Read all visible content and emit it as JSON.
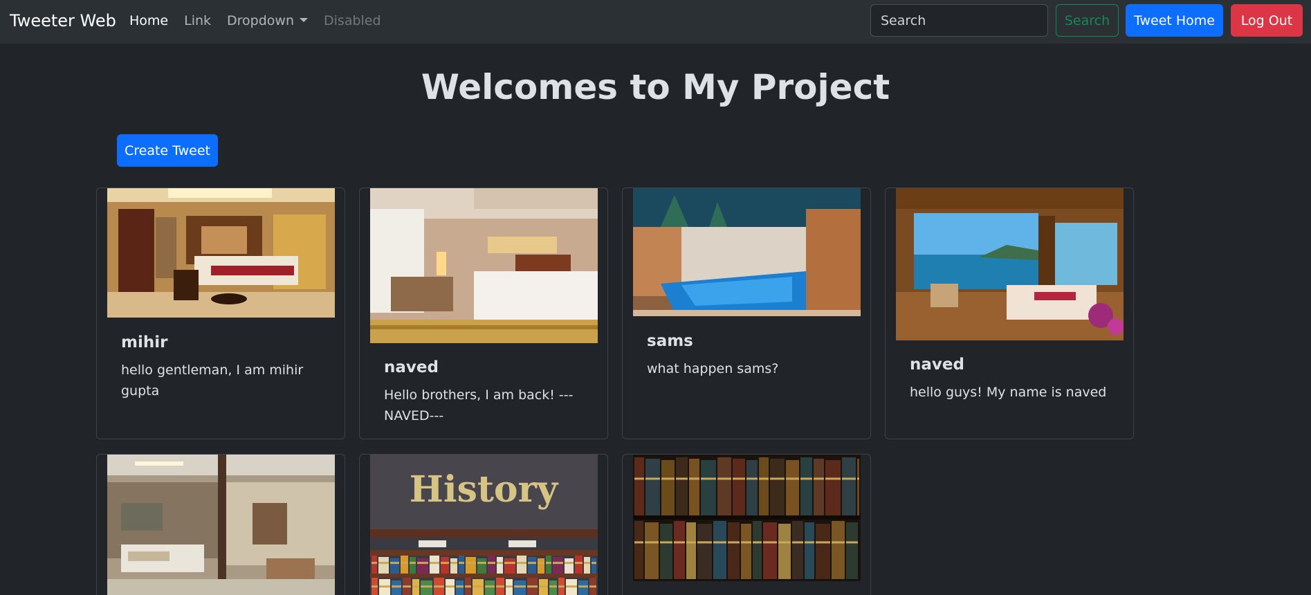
{
  "navbar": {
    "brand": "Tweeter Web",
    "links": [
      {
        "label": "Home",
        "state": "active"
      },
      {
        "label": "Link",
        "state": "normal"
      },
      {
        "label": "Dropdown",
        "state": "dropdown"
      },
      {
        "label": "Disabled",
        "state": "disabled"
      }
    ],
    "search_placeholder": "Search",
    "search_button": "Search",
    "tweet_home_button": "Tweet Home",
    "logout_button": "Log Out"
  },
  "page": {
    "title": "Welcomes to My Project",
    "create_button": "Create Tweet"
  },
  "tweets": [
    {
      "user": "mihir",
      "text": "hello gentleman, I am mihir gupta",
      "image": "hotel-room-photo"
    },
    {
      "user": "naved",
      "text": "Hello brothers, I am back! ---NAVED---",
      "image": "twin-bed-room-photo"
    },
    {
      "user": "sams",
      "text": "what happen sams?",
      "image": "indoor-pool-photo"
    },
    {
      "user": "naved",
      "text": "hello guys! My name is naved",
      "image": "sea-view-room-photo"
    },
    {
      "user": "",
      "text": "",
      "image": "suite-room-photo"
    },
    {
      "user": "",
      "text": "",
      "image": "history-bookstore-photo",
      "image_text": "History"
    },
    {
      "user": "",
      "text": "",
      "image": "old-books-photo"
    }
  ],
  "colors": {
    "background": "#212529",
    "navbar": "#2b3035",
    "primary": "#0d6efd",
    "success": "#198754",
    "danger": "#dc3545"
  }
}
